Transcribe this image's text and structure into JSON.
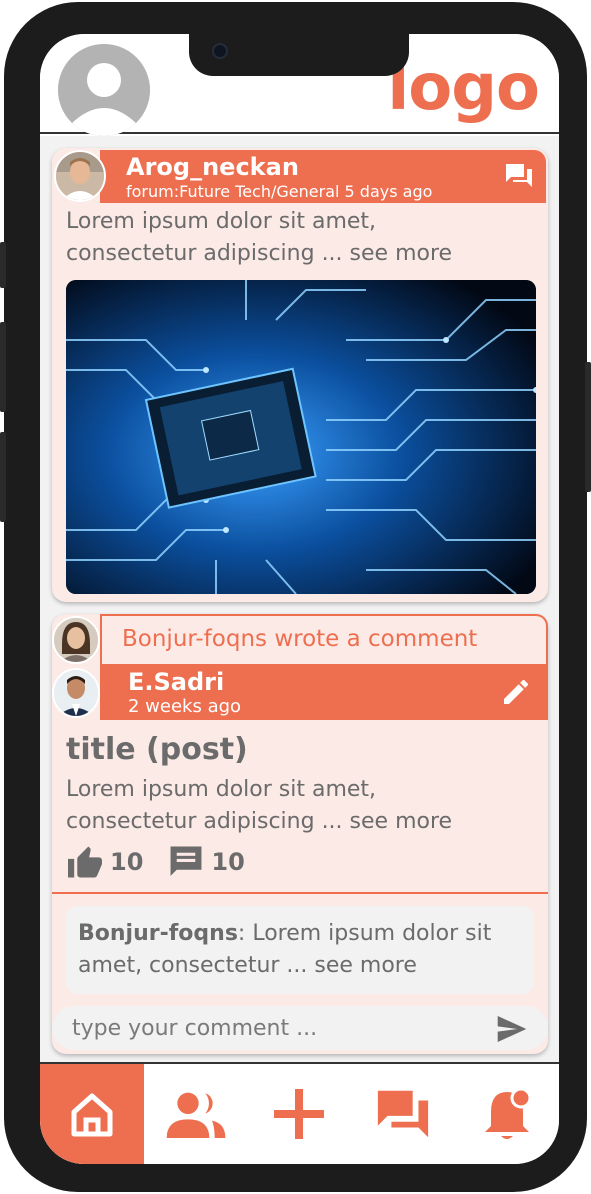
{
  "header": {
    "logo_text": "logo",
    "profile_icon": "user-avatar-icon"
  },
  "post": {
    "username": "Arog_neckan",
    "meta": "forum:Future Tech/General 5 days ago",
    "excerpt_line1": "Lorem ipsum dolor sit amet,",
    "excerpt_line2": "consectetur adipiscing ... see more",
    "action_icon": "chat-icon"
  },
  "activity": {
    "header_text": "Bonjur-foqns wrote a comment",
    "author": "E.Sadri",
    "time": "2 weeks ago",
    "title": "title (post)",
    "excerpt_line1": "Lorem ipsum dolor sit amet,",
    "excerpt_line2": "consectetur adipiscing ... see more",
    "likes": "10",
    "comments": "10",
    "reply_author": "Bonjur-foqns",
    "reply_text": ": Lorem ipsum dolor sit amet, consectetur ... see more",
    "input_placeholder": "type your comment ..."
  },
  "nav": {
    "items": [
      "home-icon",
      "people-icon",
      "add-icon",
      "messages-icon",
      "notification-icon"
    ],
    "active": "home-icon"
  },
  "colors": {
    "accent": "#ee6f50",
    "card_bg": "#fbeae6",
    "text": "#6b6b6b"
  }
}
